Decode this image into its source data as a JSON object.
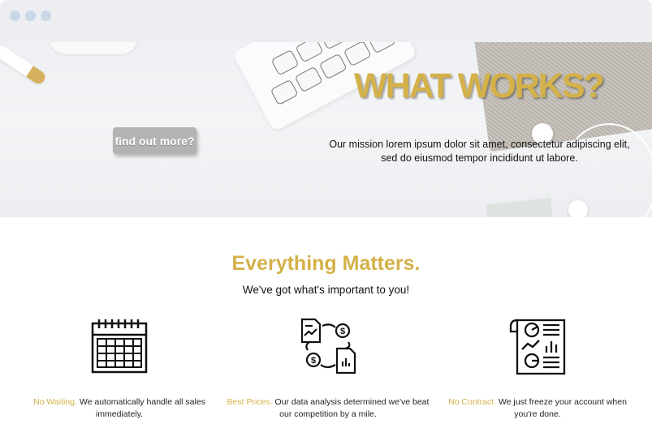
{
  "hero": {
    "button_label": "find out more?",
    "title": "WHAT WORKS?",
    "mission": "Our mission lorem ipsum dolor sit amet, consectetur adipiscing elit, sed do eiusmod tempor incididunt ut labore."
  },
  "features_section": {
    "title": "Everything Matters.",
    "subtitle": "We've got what's important to you!",
    "items": [
      {
        "icon": "calendar-icon",
        "lead": "No Waiting.",
        "text": " We automatically handle all sales immediately."
      },
      {
        "icon": "data-exchange-icon",
        "lead": "Best Prices.",
        "text": " Our data analysis determined we've beat our competition by a mile."
      },
      {
        "icon": "report-icon",
        "lead": "No Contract.",
        "text": " We just freeze your account when you're done."
      }
    ]
  },
  "colors": {
    "accent_gold": "#d4b149",
    "button_gray": "#b3b3b3",
    "titlebar": "#eceef2",
    "window_dots": "#c9d7e6"
  }
}
